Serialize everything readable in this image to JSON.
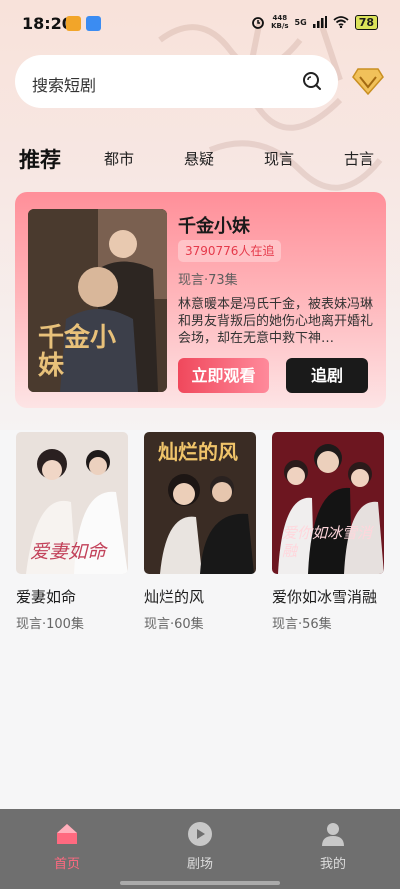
{
  "status": {
    "time": "18:20",
    "net_speed": "448\nKB/s",
    "network": "5G",
    "battery": "78"
  },
  "search": {
    "placeholder": "搜索短剧"
  },
  "tabs": [
    {
      "label": "推荐",
      "active": true
    },
    {
      "label": "都市"
    },
    {
      "label": "悬疑"
    },
    {
      "label": "现言"
    },
    {
      "label": "古言"
    }
  ],
  "featured": {
    "title": "千金小妹",
    "viewers": "3790776人在追",
    "meta": "现言·73集",
    "description": "林意暖本是冯氏千金，被表妹冯琳和男友背叛后的她伤心地离开婚礼会场，却在无意中救下神…",
    "watch_label": "立即观看",
    "follow_label": "追剧",
    "poster_text": "千金小妹"
  },
  "dramas": [
    {
      "title": "爱妻如命",
      "meta": "现言·100集",
      "poster_text": "爱妻如命"
    },
    {
      "title": "灿烂的风",
      "meta": "现言·60集",
      "poster_text": "灿烂的风"
    },
    {
      "title": "爱你如冰雪消融",
      "meta": "现言·56集",
      "poster_text": "爱你如冰雪消融"
    }
  ],
  "nav": [
    {
      "label": "首页",
      "icon": "home-icon",
      "active": true
    },
    {
      "label": "剧场",
      "icon": "play-icon"
    },
    {
      "label": "我的",
      "icon": "profile-icon"
    }
  ],
  "colors": {
    "accent": "#f0485c",
    "nav_active": "#ff6a80",
    "nav_bg": "#6f6f6f"
  }
}
